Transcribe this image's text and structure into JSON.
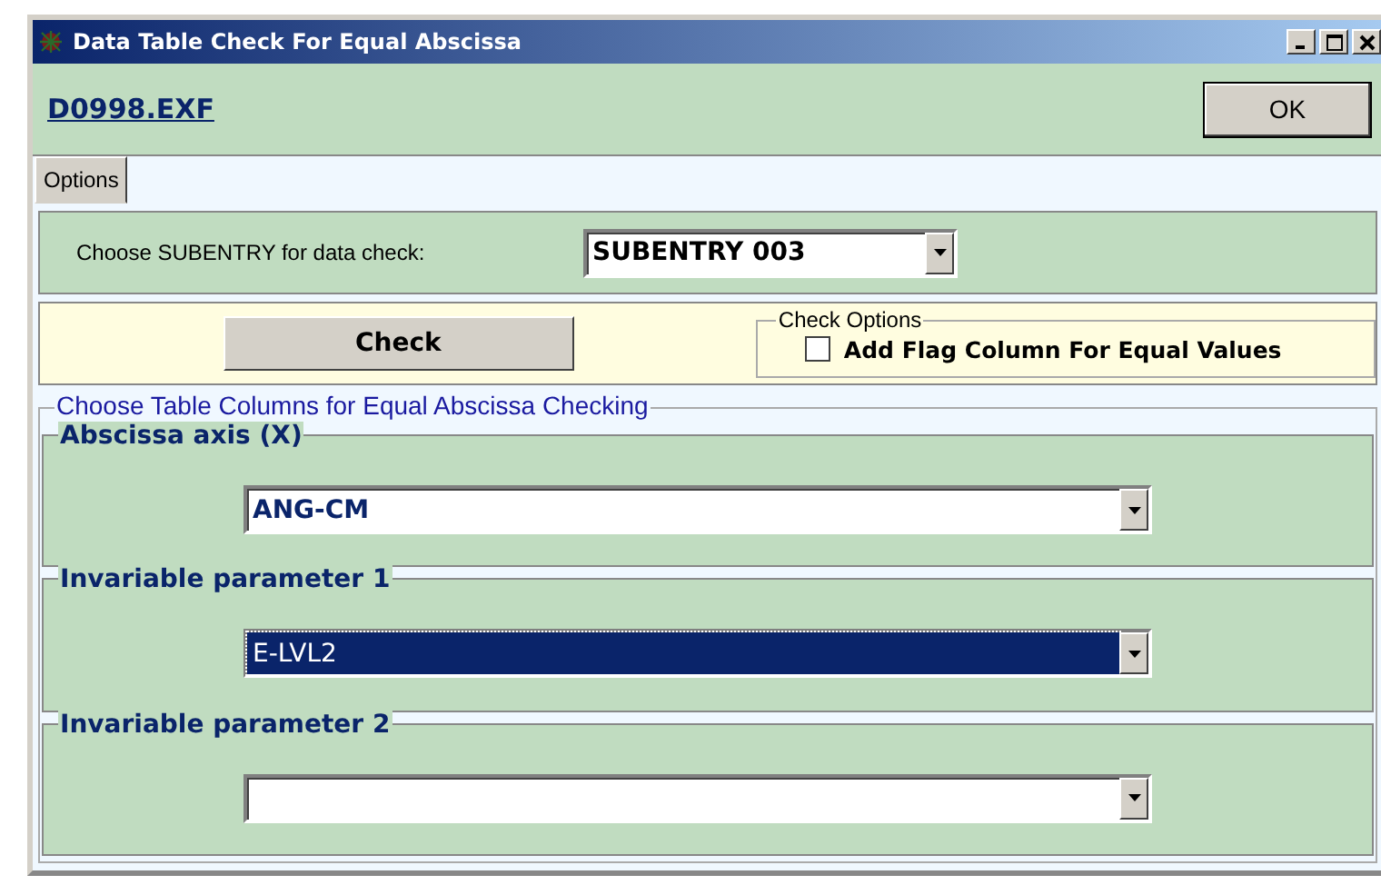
{
  "window": {
    "title": "Data Table Check For Equal Abscissa"
  },
  "file_link": "D0998.EXF",
  "ok_button": "OK",
  "tabs": [
    {
      "label": "Options",
      "selected": true
    }
  ],
  "subentry": {
    "label": "Choose SUBENTRY  for data check:",
    "value": "SUBENTRY 003"
  },
  "check_button": "Check",
  "check_options": {
    "title": "Check Options",
    "checkbox": {
      "label": "Add Flag Column For Equal  Values",
      "checked": false
    }
  },
  "columns_group": {
    "title": "Choose Table Columns for Equal Abscissa Checking",
    "groups": [
      {
        "title": "Abscissa axis (X)",
        "value": "ANG-CM",
        "focused": false
      },
      {
        "title": "Invariable parameter 1",
        "value": "E-LVL2",
        "focused": true
      },
      {
        "title": "Invariable parameter 2",
        "focused": false
      }
    ]
  }
}
